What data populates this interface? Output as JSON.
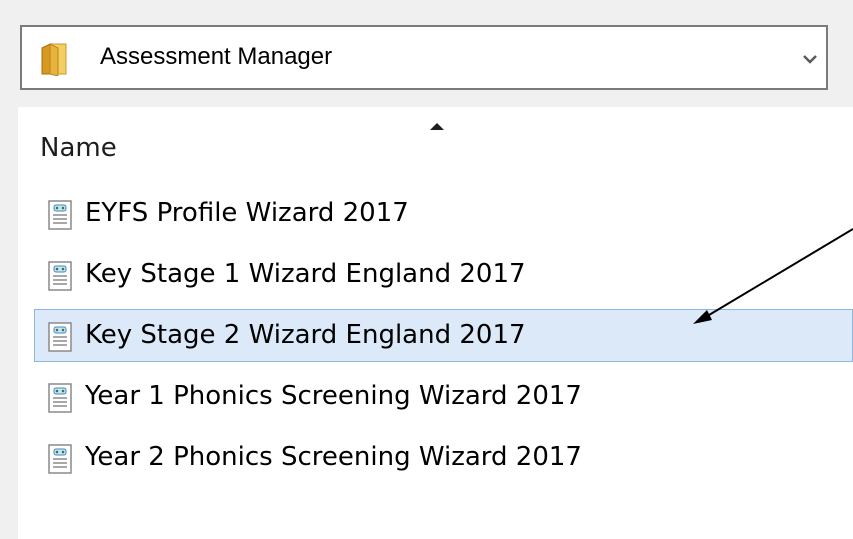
{
  "location": {
    "label": "Assessment Manager",
    "icon": "folder-icon"
  },
  "list": {
    "column_header": "Name",
    "sort_direction": "ascending",
    "selected_index": 2,
    "items": [
      {
        "label": "EYFS Profile Wizard 2017",
        "icon": "wizard-file-icon"
      },
      {
        "label": "Key Stage 1 Wizard England 2017",
        "icon": "wizard-file-icon"
      },
      {
        "label": "Key Stage 2 Wizard England 2017",
        "icon": "wizard-file-icon"
      },
      {
        "label": "Year 1 Phonics Screening Wizard 2017",
        "icon": "wizard-file-icon"
      },
      {
        "label": "Year 2 Phonics Screening Wizard 2017",
        "icon": "wizard-file-icon"
      }
    ]
  },
  "colors": {
    "selection_fill": "#dbe9f9",
    "selection_border": "#8eb6e1",
    "chrome_background": "#f0f0f0"
  }
}
